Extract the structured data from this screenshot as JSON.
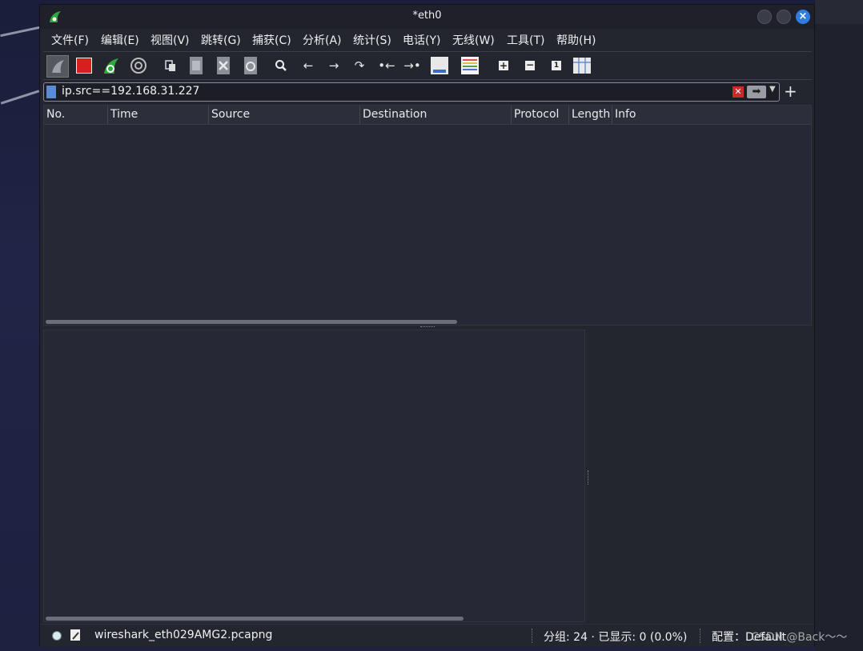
{
  "window": {
    "title": "*eth0"
  },
  "menubar": {
    "items": [
      "文件(F)",
      "编辑(E)",
      "视图(V)",
      "跳转(G)",
      "捕获(C)",
      "分析(A)",
      "统计(S)",
      "电话(Y)",
      "无线(W)",
      "工具(T)",
      "帮助(H)"
    ]
  },
  "toolbar": {
    "icons": [
      "shark-fin-start-icon",
      "stop-capture-icon",
      "restart-capture-icon",
      "capture-options-icon",
      "open-file-icon",
      "save-file-icon",
      "close-file-icon",
      "reload-file-icon",
      "find-packet-icon",
      "go-back-icon",
      "go-forward-icon",
      "go-to-packet-icon",
      "first-packet-icon",
      "last-packet-icon",
      "auto-scroll-icon",
      "colorize-icon",
      "zoom-in-icon",
      "zoom-out-icon",
      "normal-size-icon",
      "resize-columns-icon"
    ]
  },
  "filter": {
    "value": "ip.src==192.168.31.227",
    "apply_glyph": "➡",
    "add_glyph": "+"
  },
  "packet_list": {
    "columns": [
      "No.",
      "Time",
      "Source",
      "Destination",
      "Protocol",
      "Length",
      "Info"
    ],
    "rows": []
  },
  "status": {
    "file": "wireshark_eth029AMG2.pcapng",
    "packets": "分组: 24 · 已显示: 0 (0.0%)",
    "profile": "配置：Default"
  },
  "watermark": "CSDN @Back～～"
}
